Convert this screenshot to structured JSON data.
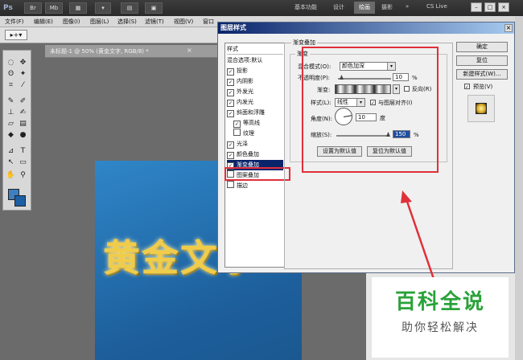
{
  "app": {
    "logo": "Ps",
    "workspaces": [
      "基本功能",
      "设计",
      "绘画",
      "摄影"
    ],
    "active_workspace": "绘画",
    "cslive": "CS Live"
  },
  "menus": [
    "文件(F)",
    "编辑(E)",
    "图像(I)",
    "图层(L)",
    "选择(S)",
    "滤镜(T)",
    "视图(V)",
    "窗口"
  ],
  "document": {
    "tab_label": "未标题-1 @ 50% (黄金文字, RGB/8) *",
    "close_glyph": "×",
    "text": "黄金文字"
  },
  "dialog": {
    "title": "图层样式",
    "close_glyph": "×",
    "styles_header": "样式",
    "blend_options": "混合选项:默认",
    "effects": [
      {
        "label": "投影",
        "checked": true
      },
      {
        "label": "内阴影",
        "checked": true
      },
      {
        "label": "外发光",
        "checked": true
      },
      {
        "label": "内发光",
        "checked": true
      },
      {
        "label": "斜面和浮雕",
        "checked": true
      },
      {
        "label": "等高线",
        "checked": true
      },
      {
        "label": "纹理",
        "checked": false
      },
      {
        "label": "光泽",
        "checked": true
      },
      {
        "label": "颜色叠加",
        "checked": true
      },
      {
        "label": "渐变叠加",
        "checked": true,
        "selected": true
      },
      {
        "label": "图案叠加",
        "checked": false
      },
      {
        "label": "描边",
        "checked": false
      }
    ],
    "panel_title": "渐变叠加",
    "group_title": "渐变",
    "blend_mode_label": "混合模式(O):",
    "blend_mode_value": "颜色加深",
    "opacity_label": "不透明度(P):",
    "opacity_value": "10",
    "percent": "%",
    "gradient_label": "渐变:",
    "reverse_label": "反向(R)",
    "style_label": "样式(L):",
    "style_value": "线性",
    "align_label": "与图层对齐(I)",
    "angle_label": "角度(N):",
    "angle_value": "10",
    "degree": "度",
    "scale_label": "缩放(S):",
    "scale_value": "150",
    "set_default": "设置为默认值",
    "reset_default": "复位为默认值",
    "ok": "确定",
    "reset": "复位",
    "new_style": "新建样式(W)...",
    "preview_label": "预览(V)",
    "preview_checked": true
  },
  "watermark": {
    "title": "百科全说",
    "subtitle": "助你轻松解决"
  },
  "colors": {
    "highlight": "#e0303a",
    "selection": "#0a246a",
    "watermark_green": "#2aa23a"
  }
}
